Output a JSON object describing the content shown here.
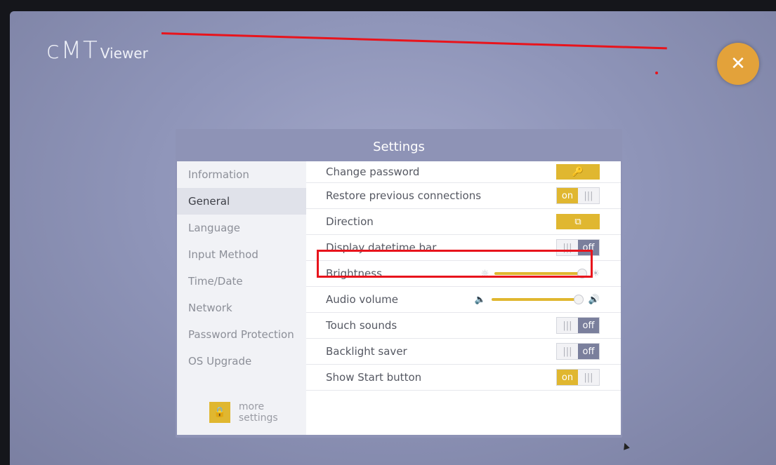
{
  "app": {
    "logo_main": "cMT",
    "logo_sub": "Viewer",
    "close_glyph": "✕"
  },
  "dialog": {
    "title": "Settings"
  },
  "sidebar": {
    "items": [
      {
        "label": "Information"
      },
      {
        "label": "General",
        "active": true
      },
      {
        "label": "Language"
      },
      {
        "label": "Input Method"
      },
      {
        "label": "Time/Date"
      },
      {
        "label": "Network"
      },
      {
        "label": "Password Protection"
      },
      {
        "label": "OS Upgrade"
      }
    ],
    "more_settings_label": "more settings",
    "more_settings_icon": "lock-icon"
  },
  "settings": {
    "change_password": {
      "label": "Change password",
      "icon": "key-icon",
      "icon_glyph": "🔑"
    },
    "restore_connections": {
      "label": "Restore previous connections",
      "state": "on",
      "handle": "|||"
    },
    "direction": {
      "label": "Direction",
      "icon": "rotate-icon",
      "icon_glyph": "⧉"
    },
    "datetime_bar": {
      "label": "Display datetime bar",
      "state": "off",
      "handle": "|||"
    },
    "brightness": {
      "label": "Brightness",
      "level": 0.95,
      "icon_low": "☼",
      "icon_high": "☀"
    },
    "audio_volume": {
      "label": "Audio volume",
      "level": 0.95,
      "icon_low": "🔈",
      "icon_high": "🔊"
    },
    "touch_sounds": {
      "label": "Touch sounds",
      "state": "off",
      "handle": "|||"
    },
    "backlight_saver": {
      "label": "Backlight saver",
      "state": "off",
      "handle": "|||"
    },
    "show_start_button": {
      "label": "Show Start button",
      "state": "on",
      "handle": "|||"
    }
  },
  "colors": {
    "accent": "#e0b730",
    "close": "#e3a23a",
    "annotation": "#e8141c",
    "toggle_off": "#7a7f9c"
  }
}
